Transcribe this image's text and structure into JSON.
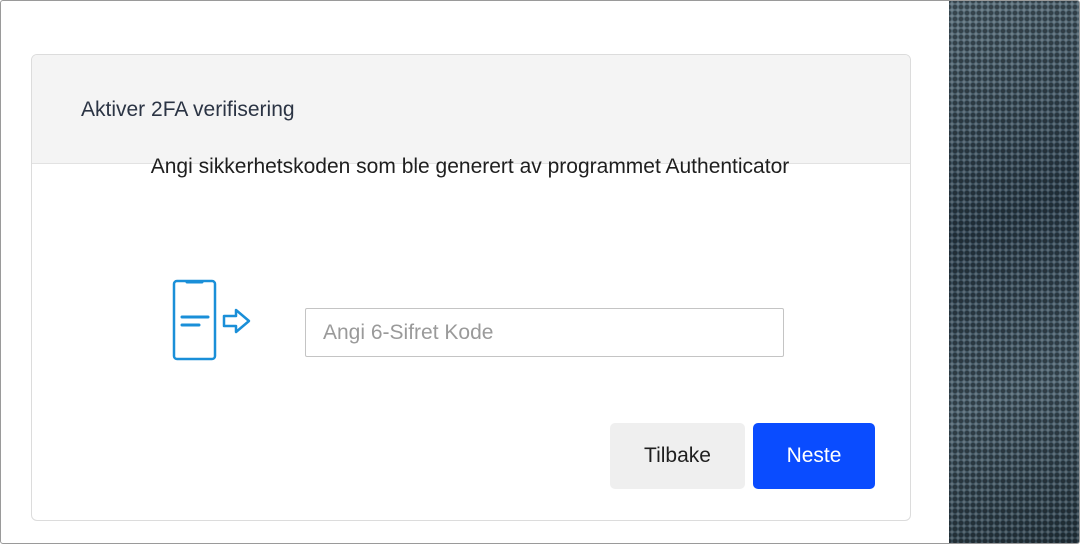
{
  "dialog": {
    "title": "Aktiver 2FA verifisering",
    "instruction": "Angi sikkerhetskoden som ble generert av programmet Authenticator",
    "code_input": {
      "value": "",
      "placeholder": "Angi 6-Sifret Kode"
    },
    "buttons": {
      "back_label": "Tilbake",
      "next_label": "Neste"
    }
  },
  "icons": {
    "phone": "phone-send-icon"
  },
  "colors": {
    "primary_button": "#0a4cff",
    "icon_accent": "#1a8fd8",
    "secondary_button": "#efefef"
  }
}
